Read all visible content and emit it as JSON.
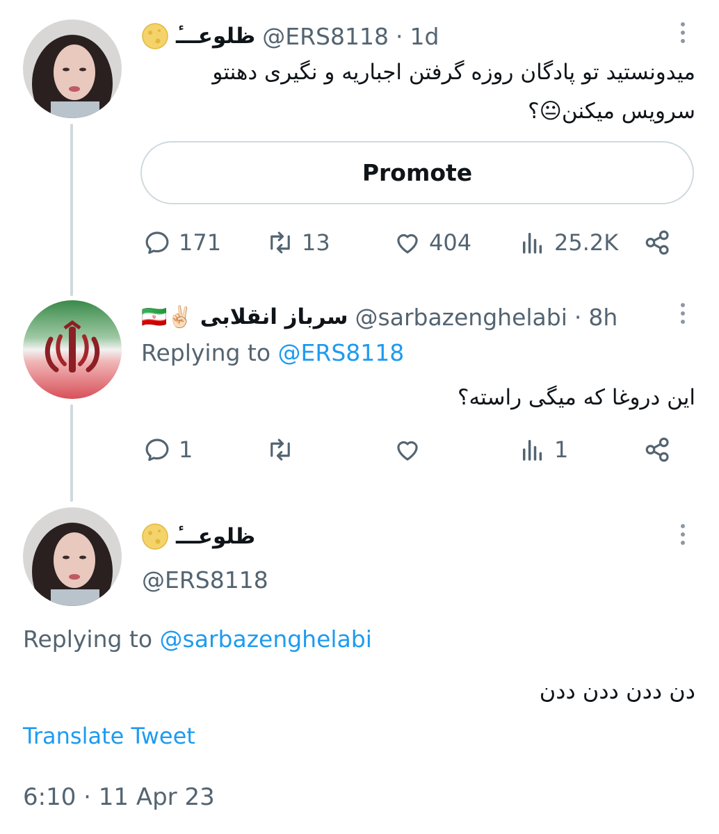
{
  "tweet1": {
    "name": "ظلوعـــٔ",
    "handle": "@ERS8118",
    "sep": "·",
    "time": "1d",
    "text_line1": "میدونستید تو پادگان روزه گرفتن اجباریه و نگیری دهنتو",
    "text_line2": "سرویس میکنن😐؟",
    "promote_label": "Promote",
    "stats": {
      "replies": "171",
      "retweets": "13",
      "likes": "404",
      "views": "25.2K"
    }
  },
  "tweet2": {
    "name": "سرباز انقلابی",
    "emojis": "🇮🇷✌🏻",
    "handle": "@sarbazenghelabi",
    "sep": "·",
    "time": "8h",
    "replying_prefix": "Replying to",
    "replying_handle": "@ERS8118",
    "text": "این دروغا که میگی راسته؟",
    "stats": {
      "replies": "1",
      "retweets": "",
      "likes": "",
      "views": "1"
    }
  },
  "tweet3": {
    "name": "ظلوعـــٔ",
    "handle": "@ERS8118",
    "replying_prefix": "Replying to",
    "replying_handle": "@sarbazenghelabi",
    "text": "دن ددن ددن ددن",
    "translate": "Translate Tweet",
    "timestamp": "6:10 · 11 Apr 23"
  },
  "colors": {
    "accent": "#1d9bf0",
    "muted": "#536471",
    "border": "#cfd9de",
    "text": "#0f1419"
  },
  "icons": [
    "reply-icon",
    "retweet-icon",
    "like-icon",
    "views-icon",
    "share-icon",
    "more-icon",
    "moon-emoji"
  ]
}
